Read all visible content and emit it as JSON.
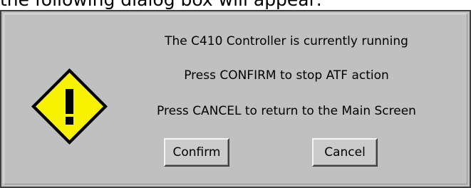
{
  "caption": "the following dialog box will appear:",
  "dialog": {
    "icon": "warning-icon",
    "lines": [
      "The C410 Controller is currently running",
      "Press CONFIRM to stop ATF action",
      "Press CANCEL to return to the Main Screen"
    ],
    "buttons": {
      "confirm": "Confirm",
      "cancel": "Cancel"
    },
    "colors": {
      "background": "#c0c0c0",
      "warning_fill": "#f7f200",
      "warning_stroke": "#000000"
    }
  }
}
